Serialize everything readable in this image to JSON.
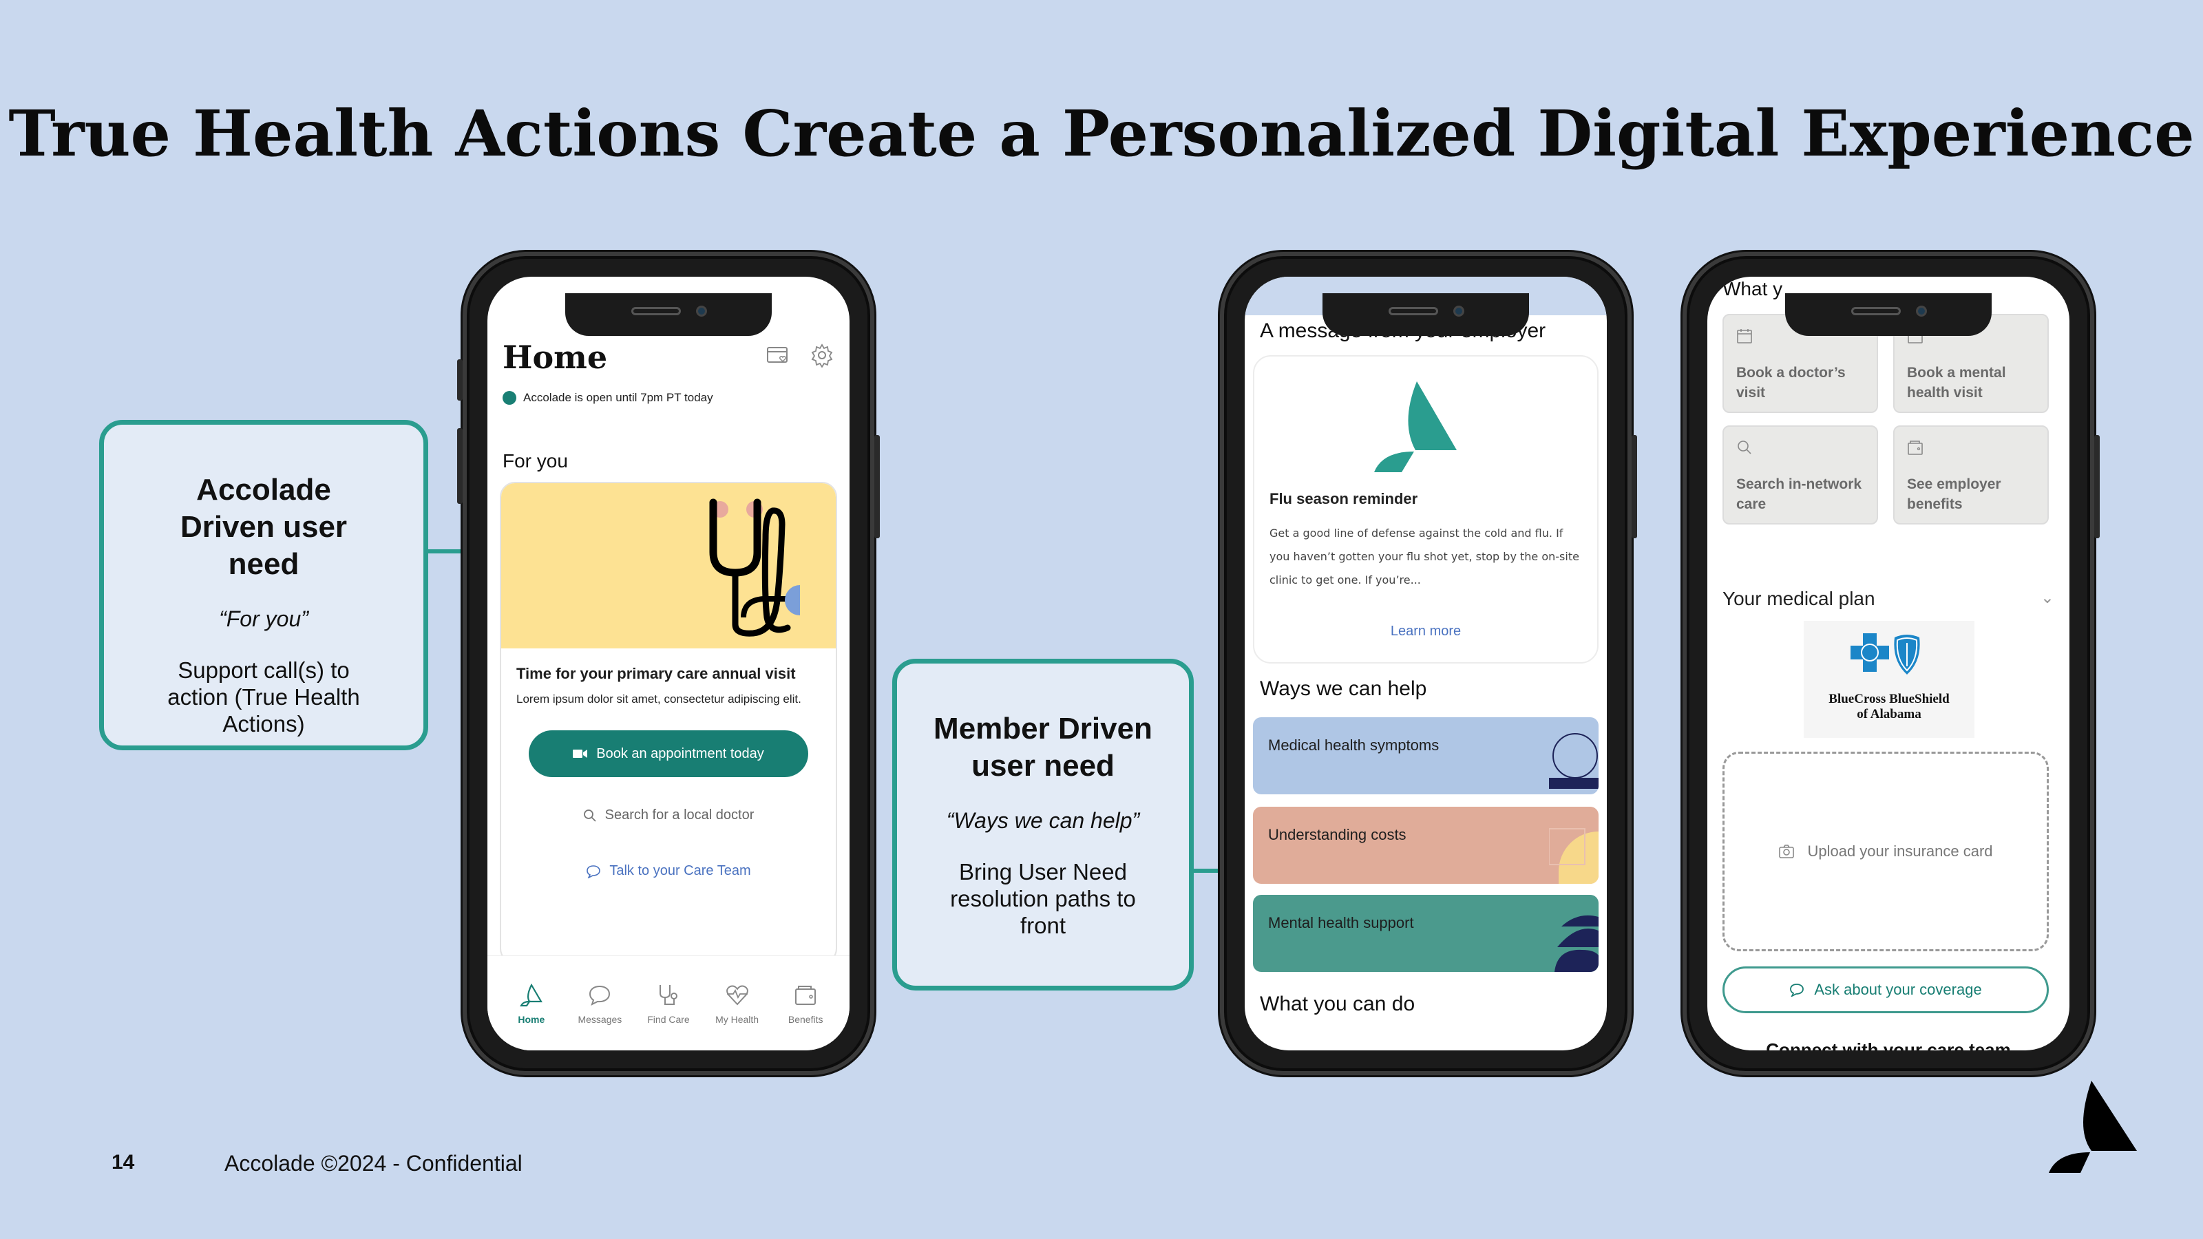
{
  "slide": {
    "title": "True Health Actions Create a Personalized Digital Experience",
    "page_number": "14",
    "footer": "Accolade ©2024 - Confidential",
    "colors": {
      "background": "#c9d8ee",
      "accent_teal": "#2a9d8f",
      "button_teal": "#187e73",
      "link_blue": "#4a72c0"
    }
  },
  "callouts": [
    {
      "title": "Accolade Driven user need",
      "quote": "“For you”",
      "description": "Support call(s) to action (True Health Actions)"
    },
    {
      "title": "Member Driven user need",
      "quote": "“Ways we can help”",
      "description": "Bring User Need resolution paths to front"
    }
  ],
  "phone_home": {
    "title": "Home",
    "header_icons": [
      "insurance-card-icon",
      "gear-icon"
    ],
    "status": "Accolade is open until 7pm PT today",
    "section": "For you",
    "card": {
      "title": "Time for your primary care annual visit",
      "description": "Lorem ipsum dolor sit amet, consectetur adipiscing elit.",
      "primary_button": "Book an appointment today",
      "search_link": "Search for a local doctor",
      "care_team_link": "Talk to your Care Team"
    },
    "tabs": [
      {
        "label": "Home",
        "icon": "accolade-logo-icon",
        "active": true
      },
      {
        "label": "Messages",
        "icon": "chat-bubble-icon",
        "active": false
      },
      {
        "label": "Find Care",
        "icon": "stethoscope-icon",
        "active": false
      },
      {
        "label": "My Health",
        "icon": "heart-pulse-icon",
        "active": false
      },
      {
        "label": "Benefits",
        "icon": "wallet-icon",
        "active": false
      }
    ]
  },
  "phone_help": {
    "employer_section": "A message from your employer",
    "message_card": {
      "title": "Flu season reminder",
      "body": "Get a good line of defense against the cold and flu. If you haven’t gotten your flu shot yet, stop by the on-site clinic to get one. If you’re...",
      "link": "Learn more"
    },
    "ways_section": "Ways we can help",
    "help_items": [
      {
        "label": "Medical health symptoms",
        "color": "#afc6e5"
      },
      {
        "label": "Understanding costs",
        "color": "#e0ac99"
      },
      {
        "label": "Mental health support",
        "color": "#4b9a8d"
      }
    ],
    "next_section": "What you can do"
  },
  "phone_plan": {
    "partial_heading": "What y",
    "actions": [
      {
        "label": "Book a doctor’s visit",
        "icon": "calendar-icon"
      },
      {
        "label": "Book a mental health visit",
        "icon": "calendar-icon"
      },
      {
        "label": "Search in-network care",
        "icon": "search-icon"
      },
      {
        "label": "See employer benefits",
        "icon": "wallet-icon"
      }
    ],
    "plan_section": "Your medical plan",
    "insurer_line1": "BlueCross BlueShield",
    "insurer_line2": "of Alabama",
    "upload_label": "Upload your insurance card",
    "coverage_button": "Ask about your coverage",
    "connect_heading": "Connect with your care team"
  }
}
